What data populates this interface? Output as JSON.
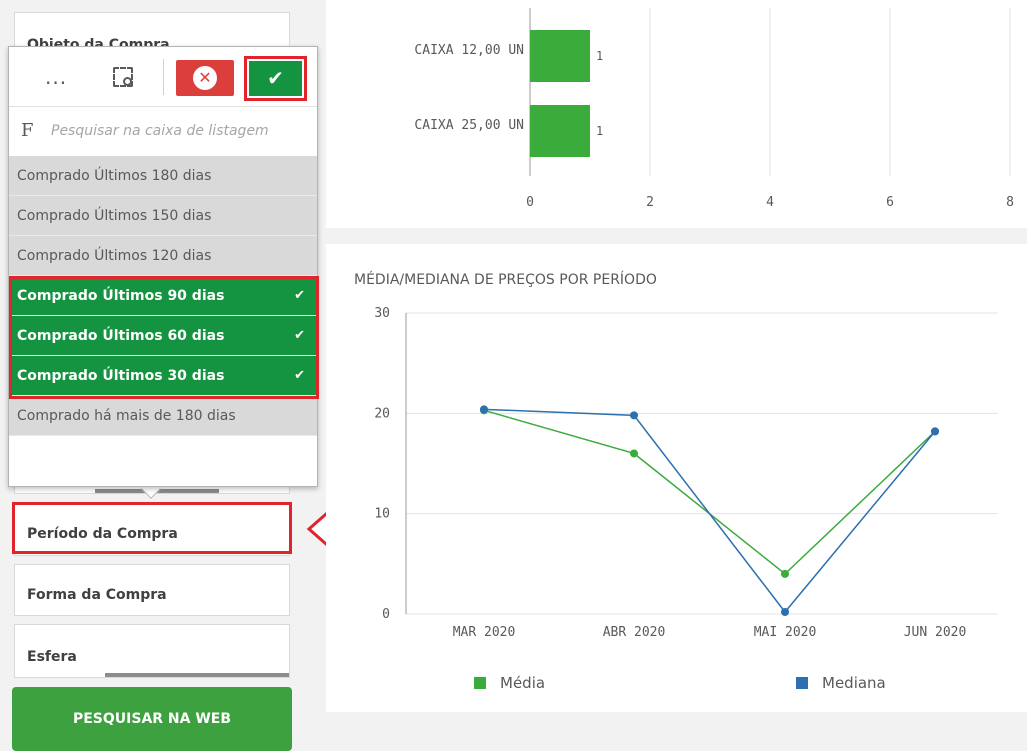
{
  "filters": {
    "objeto_label": "Objeto da Compra",
    "periodo_label": "Período da Compra",
    "forma_label": "Forma da Compra",
    "esfera_label": "Esfera"
  },
  "popup": {
    "more_icon": "...",
    "search_prefix": "F",
    "search_placeholder": "Pesquisar na caixa de listagem",
    "cancel_icon": "✕",
    "confirm_icon": "✔",
    "items": [
      {
        "label": "Comprado Últimos 180 dias",
        "selected": false
      },
      {
        "label": "Comprado Últimos 150 dias",
        "selected": false
      },
      {
        "label": "Comprado Últimos 120 dias",
        "selected": false
      },
      {
        "label": "Comprado Últimos 90 dias",
        "selected": true
      },
      {
        "label": "Comprado Últimos 60 dias",
        "selected": true
      },
      {
        "label": "Comprado Últimos 30 dias",
        "selected": true
      },
      {
        "label": "Comprado há mais de 180 dias",
        "selected": false
      }
    ],
    "check_glyph": "✔"
  },
  "search_button": "PESQUISAR NA WEB",
  "colors": {
    "selected_green": "#149441",
    "button_green": "#3da13f",
    "cancel_red": "#dc3f3b",
    "highlight_red": "#e0242c",
    "media_green": "#3bab3b",
    "mediana_blue": "#2d6fb0"
  },
  "chart_data": [
    {
      "type": "bar",
      "orientation": "horizontal",
      "categories": [
        "CAIXA 12,00 UN",
        "CAIXA 25,00 UN"
      ],
      "values": [
        1,
        1
      ],
      "value_labels": [
        "1",
        "1"
      ],
      "xlim": [
        0,
        8
      ],
      "x_ticks": [
        "0",
        "2",
        "4",
        "6",
        "8"
      ],
      "grid": true
    },
    {
      "type": "line",
      "title": "MÉDIA/MEDIANA DE PREÇOS POR PERÍODO",
      "categories": [
        "MAR 2020",
        "ABR 2020",
        "MAI 2020",
        "JUN 2020"
      ],
      "series": [
        {
          "name": "Média",
          "values": [
            20.3,
            16,
            4,
            18.2
          ]
        },
        {
          "name": "Mediana",
          "values": [
            20.4,
            19.8,
            0.2,
            18.2
          ]
        }
      ],
      "ylim": [
        0,
        30
      ],
      "y_ticks": [
        "0",
        "10",
        "20",
        "30"
      ],
      "grid": true,
      "legend": "bottom"
    }
  ]
}
